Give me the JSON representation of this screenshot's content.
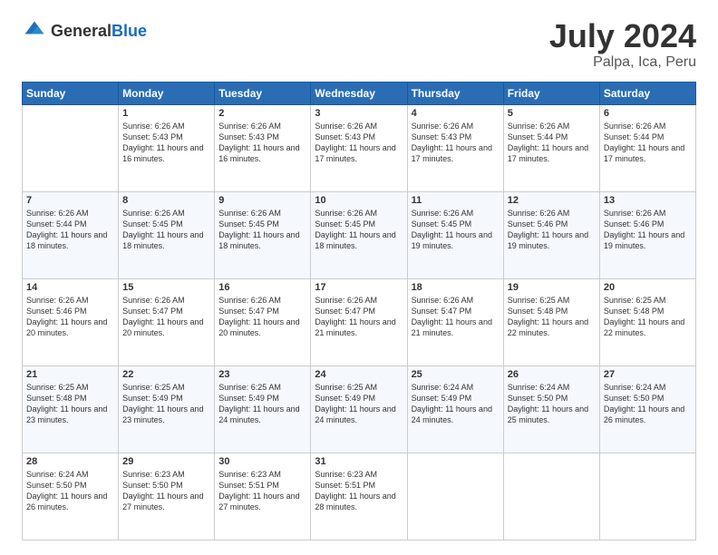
{
  "header": {
    "logo_general": "General",
    "logo_blue": "Blue",
    "title": "July 2024",
    "subtitle": "Palpa, Ica, Peru"
  },
  "days_of_week": [
    "Sunday",
    "Monday",
    "Tuesday",
    "Wednesday",
    "Thursday",
    "Friday",
    "Saturday"
  ],
  "weeks": [
    [
      {
        "day": "",
        "sunrise": "",
        "sunset": "",
        "daylight": ""
      },
      {
        "day": "1",
        "sunrise": "Sunrise: 6:26 AM",
        "sunset": "Sunset: 5:43 PM",
        "daylight": "Daylight: 11 hours and 16 minutes."
      },
      {
        "day": "2",
        "sunrise": "Sunrise: 6:26 AM",
        "sunset": "Sunset: 5:43 PM",
        "daylight": "Daylight: 11 hours and 16 minutes."
      },
      {
        "day": "3",
        "sunrise": "Sunrise: 6:26 AM",
        "sunset": "Sunset: 5:43 PM",
        "daylight": "Daylight: 11 hours and 17 minutes."
      },
      {
        "day": "4",
        "sunrise": "Sunrise: 6:26 AM",
        "sunset": "Sunset: 5:43 PM",
        "daylight": "Daylight: 11 hours and 17 minutes."
      },
      {
        "day": "5",
        "sunrise": "Sunrise: 6:26 AM",
        "sunset": "Sunset: 5:44 PM",
        "daylight": "Daylight: 11 hours and 17 minutes."
      },
      {
        "day": "6",
        "sunrise": "Sunrise: 6:26 AM",
        "sunset": "Sunset: 5:44 PM",
        "daylight": "Daylight: 11 hours and 17 minutes."
      }
    ],
    [
      {
        "day": "7",
        "sunrise": "Sunrise: 6:26 AM",
        "sunset": "Sunset: 5:44 PM",
        "daylight": "Daylight: 11 hours and 18 minutes."
      },
      {
        "day": "8",
        "sunrise": "Sunrise: 6:26 AM",
        "sunset": "Sunset: 5:45 PM",
        "daylight": "Daylight: 11 hours and 18 minutes."
      },
      {
        "day": "9",
        "sunrise": "Sunrise: 6:26 AM",
        "sunset": "Sunset: 5:45 PM",
        "daylight": "Daylight: 11 hours and 18 minutes."
      },
      {
        "day": "10",
        "sunrise": "Sunrise: 6:26 AM",
        "sunset": "Sunset: 5:45 PM",
        "daylight": "Daylight: 11 hours and 18 minutes."
      },
      {
        "day": "11",
        "sunrise": "Sunrise: 6:26 AM",
        "sunset": "Sunset: 5:45 PM",
        "daylight": "Daylight: 11 hours and 19 minutes."
      },
      {
        "day": "12",
        "sunrise": "Sunrise: 6:26 AM",
        "sunset": "Sunset: 5:46 PM",
        "daylight": "Daylight: 11 hours and 19 minutes."
      },
      {
        "day": "13",
        "sunrise": "Sunrise: 6:26 AM",
        "sunset": "Sunset: 5:46 PM",
        "daylight": "Daylight: 11 hours and 19 minutes."
      }
    ],
    [
      {
        "day": "14",
        "sunrise": "Sunrise: 6:26 AM",
        "sunset": "Sunset: 5:46 PM",
        "daylight": "Daylight: 11 hours and 20 minutes."
      },
      {
        "day": "15",
        "sunrise": "Sunrise: 6:26 AM",
        "sunset": "Sunset: 5:47 PM",
        "daylight": "Daylight: 11 hours and 20 minutes."
      },
      {
        "day": "16",
        "sunrise": "Sunrise: 6:26 AM",
        "sunset": "Sunset: 5:47 PM",
        "daylight": "Daylight: 11 hours and 20 minutes."
      },
      {
        "day": "17",
        "sunrise": "Sunrise: 6:26 AM",
        "sunset": "Sunset: 5:47 PM",
        "daylight": "Daylight: 11 hours and 21 minutes."
      },
      {
        "day": "18",
        "sunrise": "Sunrise: 6:26 AM",
        "sunset": "Sunset: 5:47 PM",
        "daylight": "Daylight: 11 hours and 21 minutes."
      },
      {
        "day": "19",
        "sunrise": "Sunrise: 6:25 AM",
        "sunset": "Sunset: 5:48 PM",
        "daylight": "Daylight: 11 hours and 22 minutes."
      },
      {
        "day": "20",
        "sunrise": "Sunrise: 6:25 AM",
        "sunset": "Sunset: 5:48 PM",
        "daylight": "Daylight: 11 hours and 22 minutes."
      }
    ],
    [
      {
        "day": "21",
        "sunrise": "Sunrise: 6:25 AM",
        "sunset": "Sunset: 5:48 PM",
        "daylight": "Daylight: 11 hours and 23 minutes."
      },
      {
        "day": "22",
        "sunrise": "Sunrise: 6:25 AM",
        "sunset": "Sunset: 5:49 PM",
        "daylight": "Daylight: 11 hours and 23 minutes."
      },
      {
        "day": "23",
        "sunrise": "Sunrise: 6:25 AM",
        "sunset": "Sunset: 5:49 PM",
        "daylight": "Daylight: 11 hours and 24 minutes."
      },
      {
        "day": "24",
        "sunrise": "Sunrise: 6:25 AM",
        "sunset": "Sunset: 5:49 PM",
        "daylight": "Daylight: 11 hours and 24 minutes."
      },
      {
        "day": "25",
        "sunrise": "Sunrise: 6:24 AM",
        "sunset": "Sunset: 5:49 PM",
        "daylight": "Daylight: 11 hours and 24 minutes."
      },
      {
        "day": "26",
        "sunrise": "Sunrise: 6:24 AM",
        "sunset": "Sunset: 5:50 PM",
        "daylight": "Daylight: 11 hours and 25 minutes."
      },
      {
        "day": "27",
        "sunrise": "Sunrise: 6:24 AM",
        "sunset": "Sunset: 5:50 PM",
        "daylight": "Daylight: 11 hours and 26 minutes."
      }
    ],
    [
      {
        "day": "28",
        "sunrise": "Sunrise: 6:24 AM",
        "sunset": "Sunset: 5:50 PM",
        "daylight": "Daylight: 11 hours and 26 minutes."
      },
      {
        "day": "29",
        "sunrise": "Sunrise: 6:23 AM",
        "sunset": "Sunset: 5:50 PM",
        "daylight": "Daylight: 11 hours and 27 minutes."
      },
      {
        "day": "30",
        "sunrise": "Sunrise: 6:23 AM",
        "sunset": "Sunset: 5:51 PM",
        "daylight": "Daylight: 11 hours and 27 minutes."
      },
      {
        "day": "31",
        "sunrise": "Sunrise: 6:23 AM",
        "sunset": "Sunset: 5:51 PM",
        "daylight": "Daylight: 11 hours and 28 minutes."
      },
      {
        "day": "",
        "sunrise": "",
        "sunset": "",
        "daylight": ""
      },
      {
        "day": "",
        "sunrise": "",
        "sunset": "",
        "daylight": ""
      },
      {
        "day": "",
        "sunrise": "",
        "sunset": "",
        "daylight": ""
      }
    ]
  ]
}
